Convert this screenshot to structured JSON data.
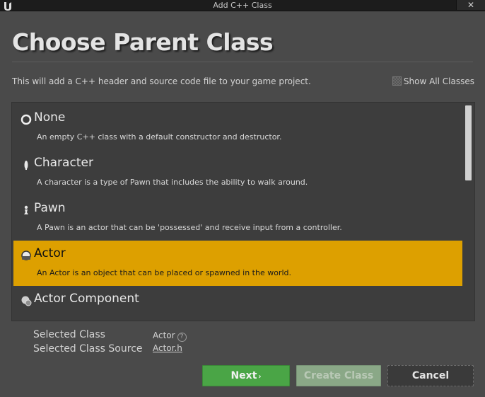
{
  "window": {
    "title": "Add C++ Class",
    "close_label": "✕"
  },
  "header": {
    "title": "Choose Parent Class",
    "description": "This will add a C++ header and source code file to your game project.",
    "show_all_label": "Show All Classes"
  },
  "classes": [
    {
      "name": "None",
      "description": "An empty C++ class with a default constructor and destructor.",
      "icon": "circle-icon",
      "selected": false
    },
    {
      "name": "Character",
      "description": "A character is a type of Pawn that includes the ability to walk around.",
      "icon": "character-icon",
      "selected": false
    },
    {
      "name": "Pawn",
      "description": "A Pawn is an actor that can be 'possessed' and receive input from a controller.",
      "icon": "pawn-icon",
      "selected": false
    },
    {
      "name": "Actor",
      "description": "An Actor is an object that can be placed or spawned in the world.",
      "icon": "actor-icon",
      "selected": true
    },
    {
      "name": "Actor Component",
      "description": "",
      "icon": "actor-component-icon",
      "selected": false
    }
  ],
  "selection": {
    "class_label": "Selected Class",
    "class_value": "Actor",
    "source_label": "Selected Class Source",
    "source_value": "Actor.h"
  },
  "buttons": {
    "next": "Next",
    "create": "Create Class",
    "cancel": "Cancel"
  },
  "colors": {
    "selected_row": "#dda000",
    "next_button": "#4aa546",
    "create_button_disabled": "#8aa887"
  }
}
